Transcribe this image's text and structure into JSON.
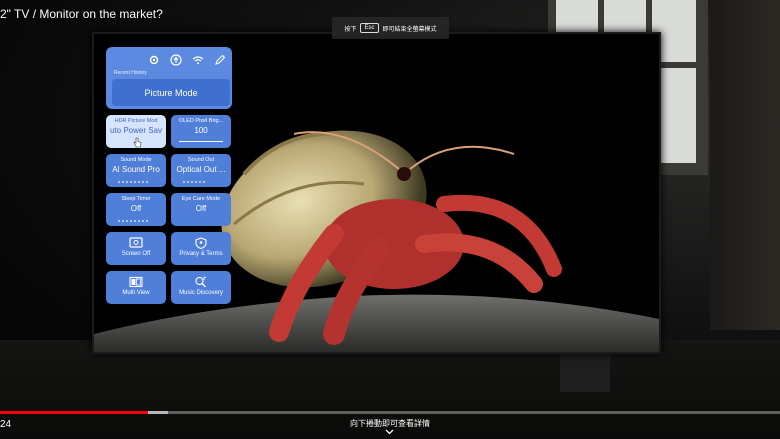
{
  "video": {
    "title": "2\" TV / Monitor on the market?",
    "time": "24",
    "progress_fraction": 0.19,
    "buffer_fraction": 0.215,
    "swipe_hint": "向下捲動即可查看詳情"
  },
  "fullscreen_hint": {
    "prefix": "按下",
    "key": "Esc",
    "suffix": "即可結束全螢幕模式"
  },
  "tv_menu": {
    "recent_history_label": "Recent History",
    "picture_mode": "Picture Mode",
    "icons": [
      "gear-icon",
      "upload-icon",
      "wifi-icon",
      "edit-icon"
    ],
    "tiles": [
      {
        "title": "HDR Picture Mod",
        "value": "uto Power Sav",
        "active": true,
        "indicator": "dots"
      },
      {
        "title": "OLED Pixel Brig...",
        "value": "100",
        "active": false,
        "indicator": "bar"
      },
      {
        "title": "Sound Mode",
        "value": "AI Sound Pro",
        "active": false,
        "indicator": "dots"
      },
      {
        "title": "Sound Out",
        "value": "Optical Out ...",
        "active": false,
        "indicator": "dots"
      },
      {
        "title": "Sleep Timer",
        "value": "Off",
        "active": false,
        "indicator": "dots"
      },
      {
        "title": "Eye Care Mode",
        "value": "Off",
        "active": false,
        "indicator": "none"
      },
      {
        "title": "",
        "label": "Screen Off",
        "icon": "screen-off-icon"
      },
      {
        "title": "",
        "label": "Privacy & Terms",
        "icon": "privacy-icon"
      },
      {
        "title": "",
        "label": "Multi View",
        "icon": "multi-view-icon"
      },
      {
        "title": "",
        "label": "Music Discovery",
        "icon": "music-discovery-icon"
      }
    ]
  },
  "colors": {
    "accent": "#5b8ae0",
    "picture_mode_bg": "#3f6fcf",
    "active_tile": "#d6e5fb",
    "progress": "#ff0000"
  }
}
